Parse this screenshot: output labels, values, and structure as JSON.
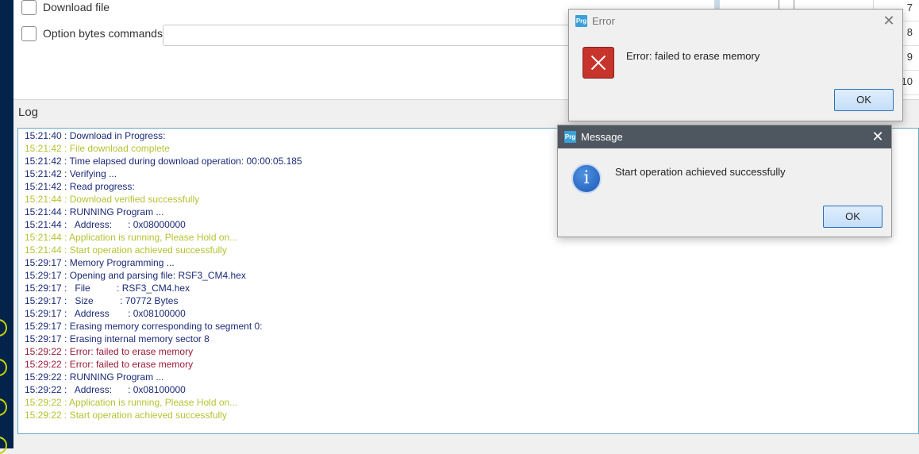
{
  "options": {
    "download_file_label": "Download file",
    "option_bytes_label": "Option bytes commands",
    "option_bytes_value": ""
  },
  "right_table": {
    "rows": [
      "7",
      "8",
      "9",
      "10"
    ]
  },
  "log": {
    "title": "Log",
    "lines": [
      {
        "text": "15:21:40 : Download in Progress:",
        "level": "info"
      },
      {
        "text": "15:21:42 : File download complete",
        "level": "success"
      },
      {
        "text": "15:21:42 : Time elapsed during download operation: 00:00:05.185",
        "level": "info"
      },
      {
        "text": "15:21:42 : Verifying ...",
        "level": "info"
      },
      {
        "text": "15:21:42 : Read progress:",
        "level": "info"
      },
      {
        "text": "15:21:44 : Download verified successfully",
        "level": "success"
      },
      {
        "text": "15:21:44 : RUNNING Program ...",
        "level": "info"
      },
      {
        "text": "15:21:44 :   Address:      : 0x08000000",
        "level": "info"
      },
      {
        "text": "15:21:44 : Application is running, Please Hold on...",
        "level": "success"
      },
      {
        "text": "15:21:44 : Start operation achieved successfully",
        "level": "success"
      },
      {
        "text": "15:29:17 : Memory Programming ...",
        "level": "info"
      },
      {
        "text": "15:29:17 : Opening and parsing file: RSF3_CM4.hex",
        "level": "info"
      },
      {
        "text": "15:29:17 :   File          : RSF3_CM4.hex",
        "level": "info"
      },
      {
        "text": "15:29:17 :   Size          : 70772 Bytes",
        "level": "info"
      },
      {
        "text": "15:29:17 :   Address       : 0x08100000",
        "level": "info"
      },
      {
        "text": "15:29:17 : Erasing memory corresponding to segment 0:",
        "level": "info"
      },
      {
        "text": "15:29:17 : Erasing internal memory sector 8",
        "level": "info"
      },
      {
        "text": "15:29:22 : Error: failed to erase memory",
        "level": "error"
      },
      {
        "text": "15:29:22 : Error: failed to erase memory",
        "level": "error"
      },
      {
        "text": "15:29:22 : RUNNING Program ...",
        "level": "info"
      },
      {
        "text": "15:29:22 :   Address:      : 0x08100000",
        "level": "info"
      },
      {
        "text": "15:29:22 : Application is running, Please Hold on...",
        "level": "success"
      },
      {
        "text": "15:29:22 : Start operation achieved successfully",
        "level": "success"
      }
    ]
  },
  "error_dialog": {
    "app_icon": "Prg",
    "title": "Error",
    "message": "Error: failed to erase memory",
    "ok_label": "OK",
    "icon": "error-x-icon"
  },
  "message_dialog": {
    "app_icon": "Prg",
    "title": "Message",
    "message": "Start operation achieved successfully",
    "ok_label": "OK",
    "icon": "info-icon",
    "info_glyph": "i"
  },
  "colors": {
    "log_info": "#1c2a78",
    "log_success": "#b6c231",
    "log_error": "#9a1b3a",
    "sidebar": "#03234b",
    "accent": "#3aa0d8"
  }
}
